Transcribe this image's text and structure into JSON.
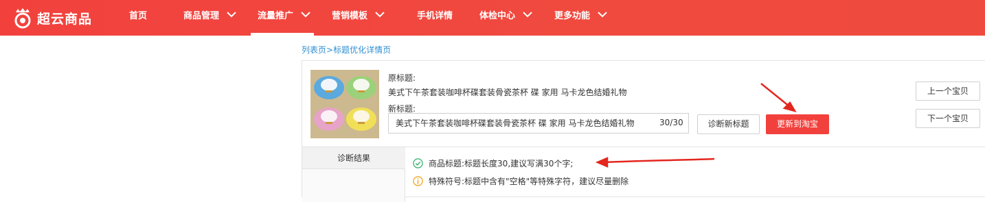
{
  "brand": {
    "name": "超云商品",
    "accent": "#f2413d"
  },
  "nav": {
    "items": [
      {
        "label": "首页",
        "has_dropdown": false,
        "active": false
      },
      {
        "label": "商品管理",
        "has_dropdown": true,
        "active": false
      },
      {
        "label": "流量推广",
        "has_dropdown": true,
        "active": true
      },
      {
        "label": "营销模板",
        "has_dropdown": true,
        "active": false
      },
      {
        "label": "手机详情",
        "has_dropdown": false,
        "active": false
      },
      {
        "label": "体检中心",
        "has_dropdown": true,
        "active": false
      },
      {
        "label": "更多功能",
        "has_dropdown": true,
        "active": false
      }
    ]
  },
  "breadcrumb": {
    "list_page": "列表页",
    "separator": ">",
    "current": "标题优化详情页"
  },
  "product": {
    "original_label": "原标题:",
    "original_title": "美式下午茶套装咖啡杯碟套装骨瓷茶杯 碟 家用 马卡龙色结婚礼物",
    "new_label": "新标题:",
    "new_title_value": "美式下午茶套装咖啡杯碟套装骨瓷茶杯 碟 家用 马卡龙色结婚礼物",
    "char_count": "30/30"
  },
  "actions": {
    "diagnose_label": "诊断新标题",
    "update_label": "更新到淘宝",
    "prev_label": "上一个宝贝",
    "next_label": "下一个宝贝"
  },
  "diagnosis": {
    "header": "诊断结果",
    "results": [
      {
        "status": "ok",
        "icon": "check-circle-icon",
        "color": "#3cb371",
        "text": "商品标题:标题长度30,建议写满30个字;"
      },
      {
        "status": "warning",
        "icon": "info-circle-icon",
        "color": "#f5a623",
        "text": "特殊符号:标题中含有\"空格\"等特殊字符，建议尽量删除"
      }
    ]
  }
}
